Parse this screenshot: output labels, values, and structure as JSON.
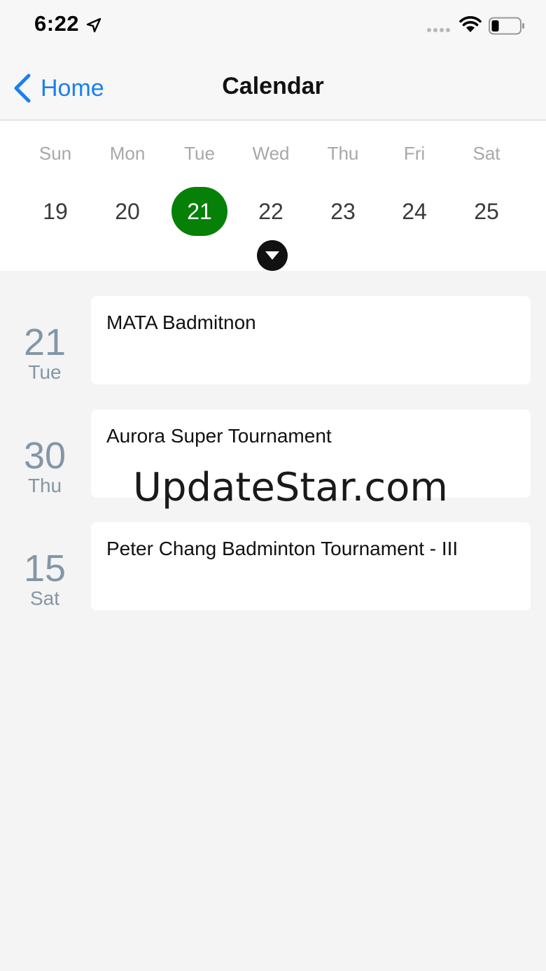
{
  "status_bar": {
    "time": "6:22"
  },
  "nav": {
    "back_label": "Home",
    "title": "Calendar"
  },
  "week": {
    "days": [
      {
        "name": "Sun",
        "num": "19"
      },
      {
        "name": "Mon",
        "num": "20"
      },
      {
        "name": "Tue",
        "num": "21"
      },
      {
        "name": "Wed",
        "num": "22"
      },
      {
        "name": "Thu",
        "num": "23"
      },
      {
        "name": "Fri",
        "num": "24"
      },
      {
        "name": "Sat",
        "num": "25"
      }
    ],
    "selected_day": "21"
  },
  "events": [
    {
      "day_num": "21",
      "day_name": "Tue",
      "title": "MATA Badmitnon"
    },
    {
      "day_num": "30",
      "day_name": "Thu",
      "title": "Aurora Super Tournament"
    },
    {
      "day_num": "15",
      "day_name": "Sat",
      "title": "Peter Chang Badminton Tournament - III"
    }
  ],
  "watermark": "UpdateStar.com",
  "colors": {
    "accent_blue": "#1a7ff2",
    "selected_green": "#078007",
    "background": "#f4f4f4"
  }
}
